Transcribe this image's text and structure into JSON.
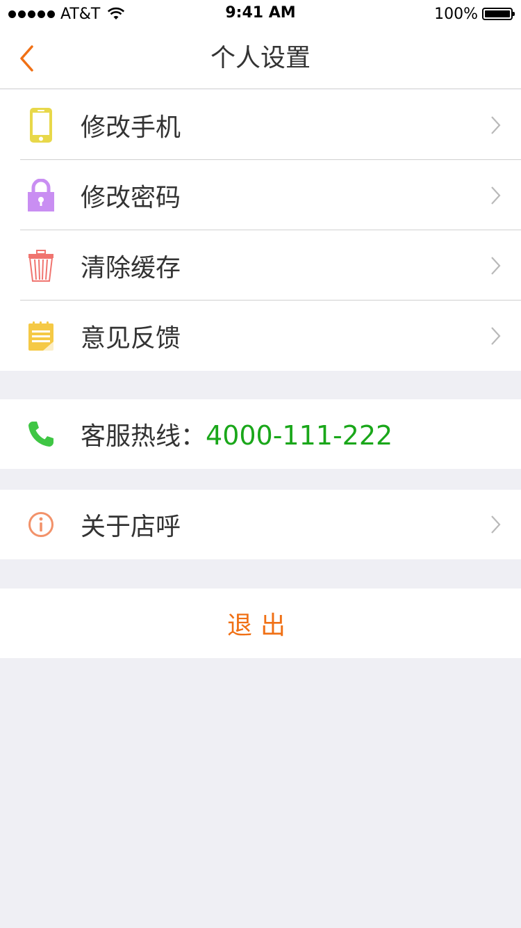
{
  "status_bar": {
    "carrier": "AT&T",
    "time": "9:41 AM",
    "battery": "100%"
  },
  "nav": {
    "title": "个人设置"
  },
  "menu": {
    "items": [
      {
        "label": "修改手机",
        "icon": "phone-icon"
      },
      {
        "label": "修改密码",
        "icon": "lock-icon"
      },
      {
        "label": "清除缓存",
        "icon": "trash-icon"
      },
      {
        "label": "意见反馈",
        "icon": "notepad-icon"
      }
    ]
  },
  "hotline": {
    "label": "客服热线：",
    "number": "4000-111-222",
    "icon": "telephone-icon"
  },
  "about": {
    "label": "关于店呼",
    "icon": "info-icon"
  },
  "logout": {
    "label": "退出"
  },
  "colors": {
    "accent": "#f07015",
    "hotline": "#1aa71a",
    "background": "#efeff4"
  }
}
